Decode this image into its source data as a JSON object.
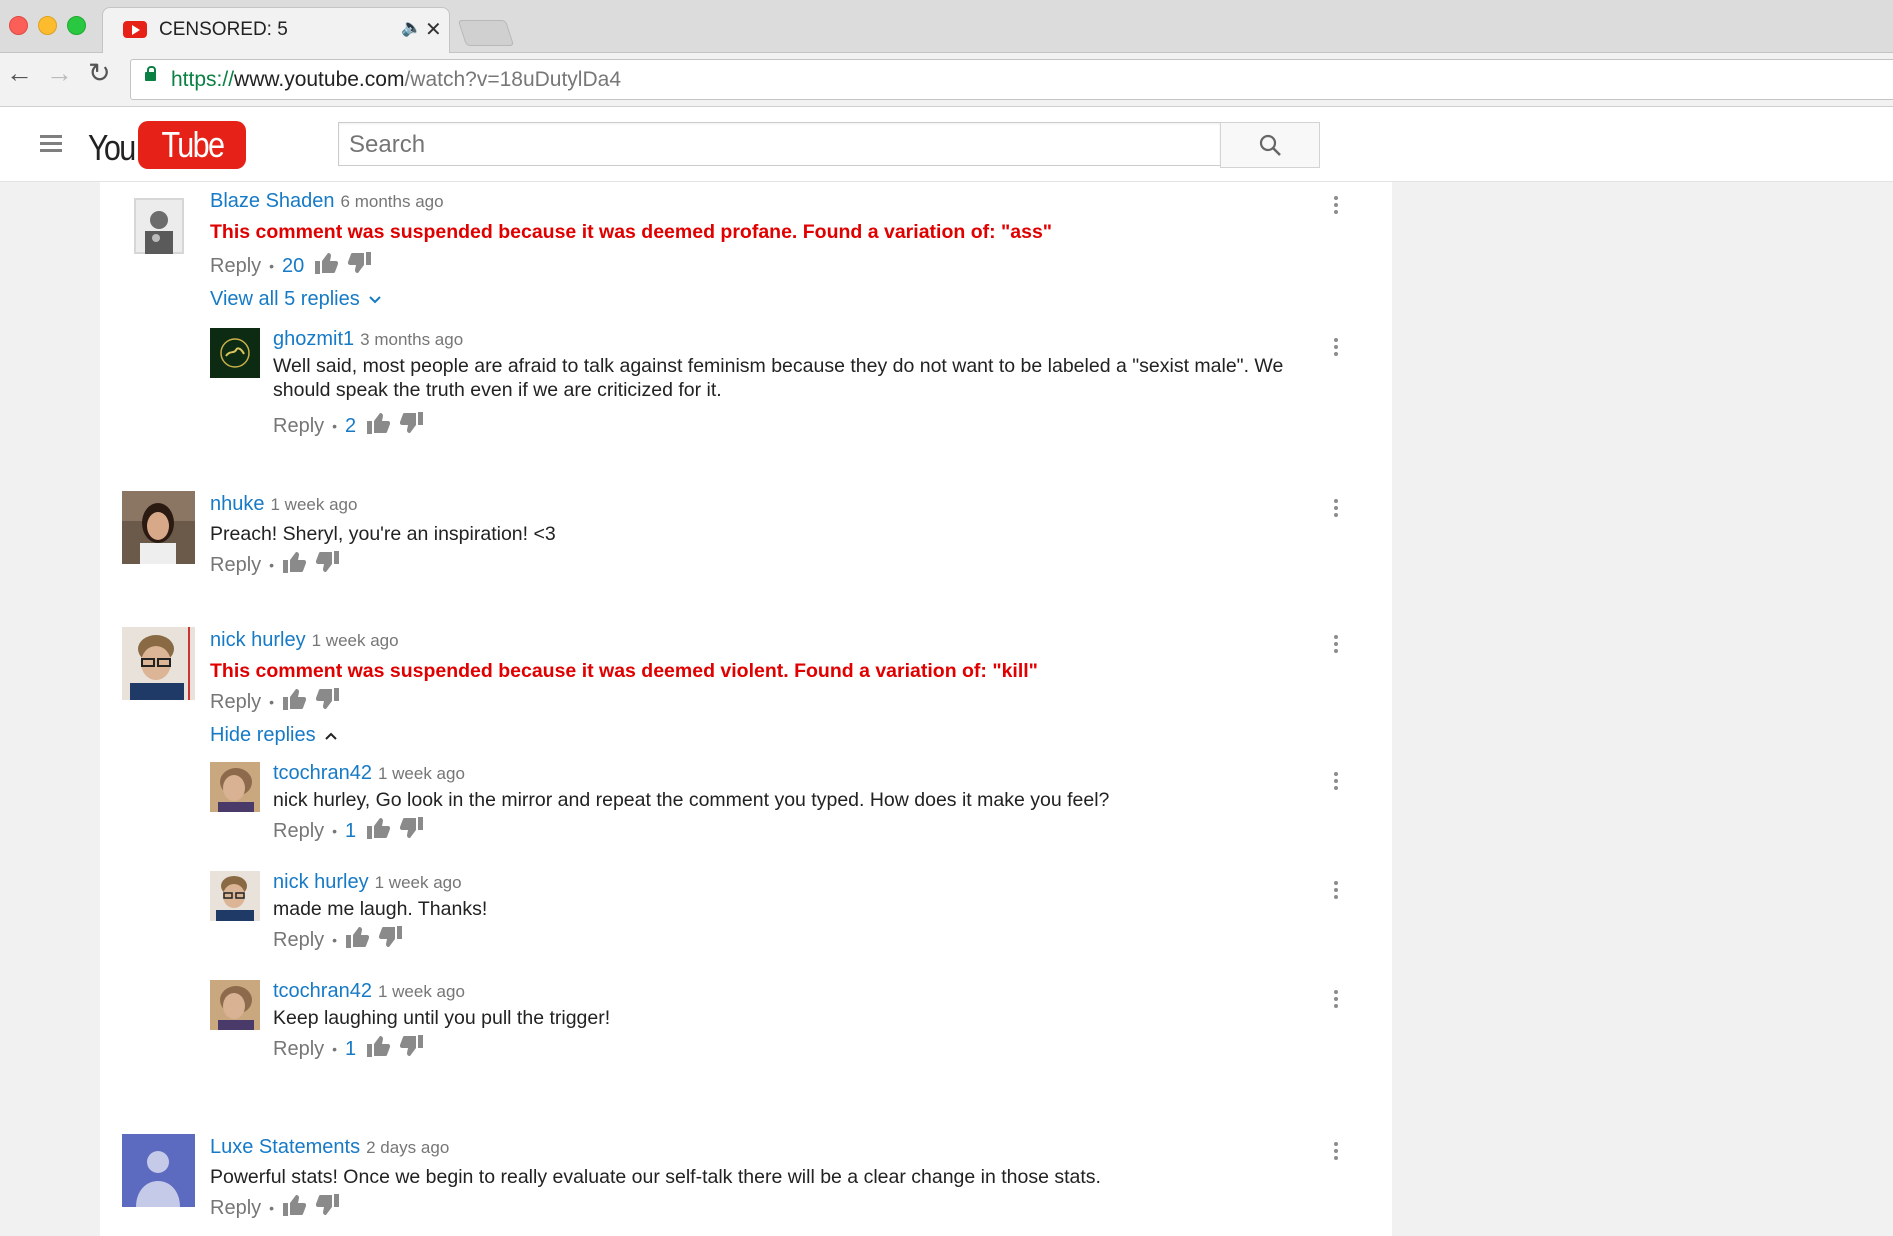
{
  "browser": {
    "tab_title": "CENSORED: 5",
    "url_scheme": "https://",
    "url_host": "www.youtube.com",
    "url_path": "/watch?v=18uDutylDa4"
  },
  "header": {
    "logo_you": "You",
    "logo_tube": "Tube",
    "search_placeholder": "Search"
  },
  "colors": {
    "link_blue": "#167ac6",
    "suspended_red": "#e00000",
    "youtube_red": "#e62117"
  },
  "comments": [
    {
      "author": "Blaze Shaden",
      "time": "6 months ago",
      "text": "This comment was suspended because it was deemed profane. Found a variation of: \"ass\"",
      "reply_label": "Reply",
      "likes": "20",
      "toggle": "View all 5 replies",
      "replies": [
        {
          "author": "ghozmit1",
          "time": "3 months ago",
          "text_line1": "Well said, most people are afraid to talk against feminism because they do not want to be labeled a \"sexist male\". We",
          "text_line2": "should speak the truth even if we are criticized for it.",
          "reply_label": "Reply",
          "likes": "2"
        }
      ]
    },
    {
      "author": "nhuke",
      "time": "1 week ago",
      "text": "Preach! Sheryl, you're an inspiration! <3",
      "reply_label": "Reply",
      "likes": ""
    },
    {
      "author": "nick hurley",
      "time": "1 week ago",
      "text": "This comment was suspended because it was deemed violent. Found a variation of: \"kill\"",
      "reply_label": "Reply",
      "likes": "",
      "toggle": "Hide replies",
      "replies": [
        {
          "author": "tcochran42",
          "time": "1 week ago",
          "text": "nick hurley, Go look in the mirror and repeat the comment you typed. How does it make you feel?",
          "reply_label": "Reply",
          "likes": "1"
        },
        {
          "author": "nick hurley",
          "time": "1 week ago",
          "text": "made me laugh. Thanks!",
          "reply_label": "Reply",
          "likes": ""
        },
        {
          "author": "tcochran42",
          "time": "1 week ago",
          "text": "Keep laughing until you pull the trigger!",
          "reply_label": "Reply",
          "likes": "1"
        }
      ]
    },
    {
      "author": "Luxe Statements",
      "time": "2 days ago",
      "text": "Powerful stats! Once we begin to really evaluate our self-talk there will be a clear change in those stats.",
      "reply_label": "Reply",
      "likes": ""
    }
  ]
}
